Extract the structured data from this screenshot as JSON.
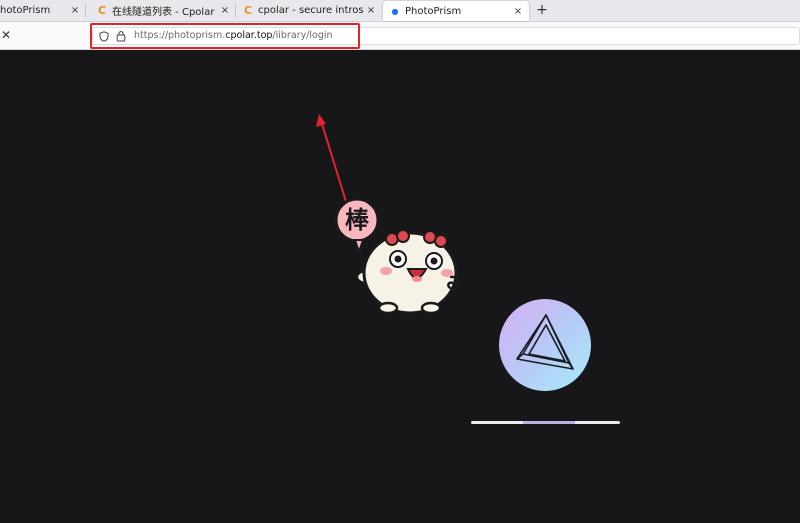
{
  "browser": {
    "tabs": [
      {
        "title": "hotoPrism",
        "icon": "photoprism-favicon"
      },
      {
        "title": "在线隧道列表 - Cpolar",
        "icon": "cpolar-favicon"
      },
      {
        "title": "cpolar - secure introspecta",
        "icon": "cpolar-favicon"
      },
      {
        "title": "PhotoPrism",
        "icon": "photoprism-favicon",
        "active": true
      }
    ],
    "close_glyph": "×",
    "new_tab_glyph": "+",
    "stop_glyph": "✕",
    "favicon_letter": "C",
    "address": {
      "prefix": "https://photoprism.",
      "domain": "cpolar.top",
      "path": "/library/login"
    }
  },
  "annotation": {
    "highlight_color": "#e0262a",
    "sticker_text": "棒"
  },
  "page": {
    "background": "#171619",
    "loading_progress": 0.35
  }
}
